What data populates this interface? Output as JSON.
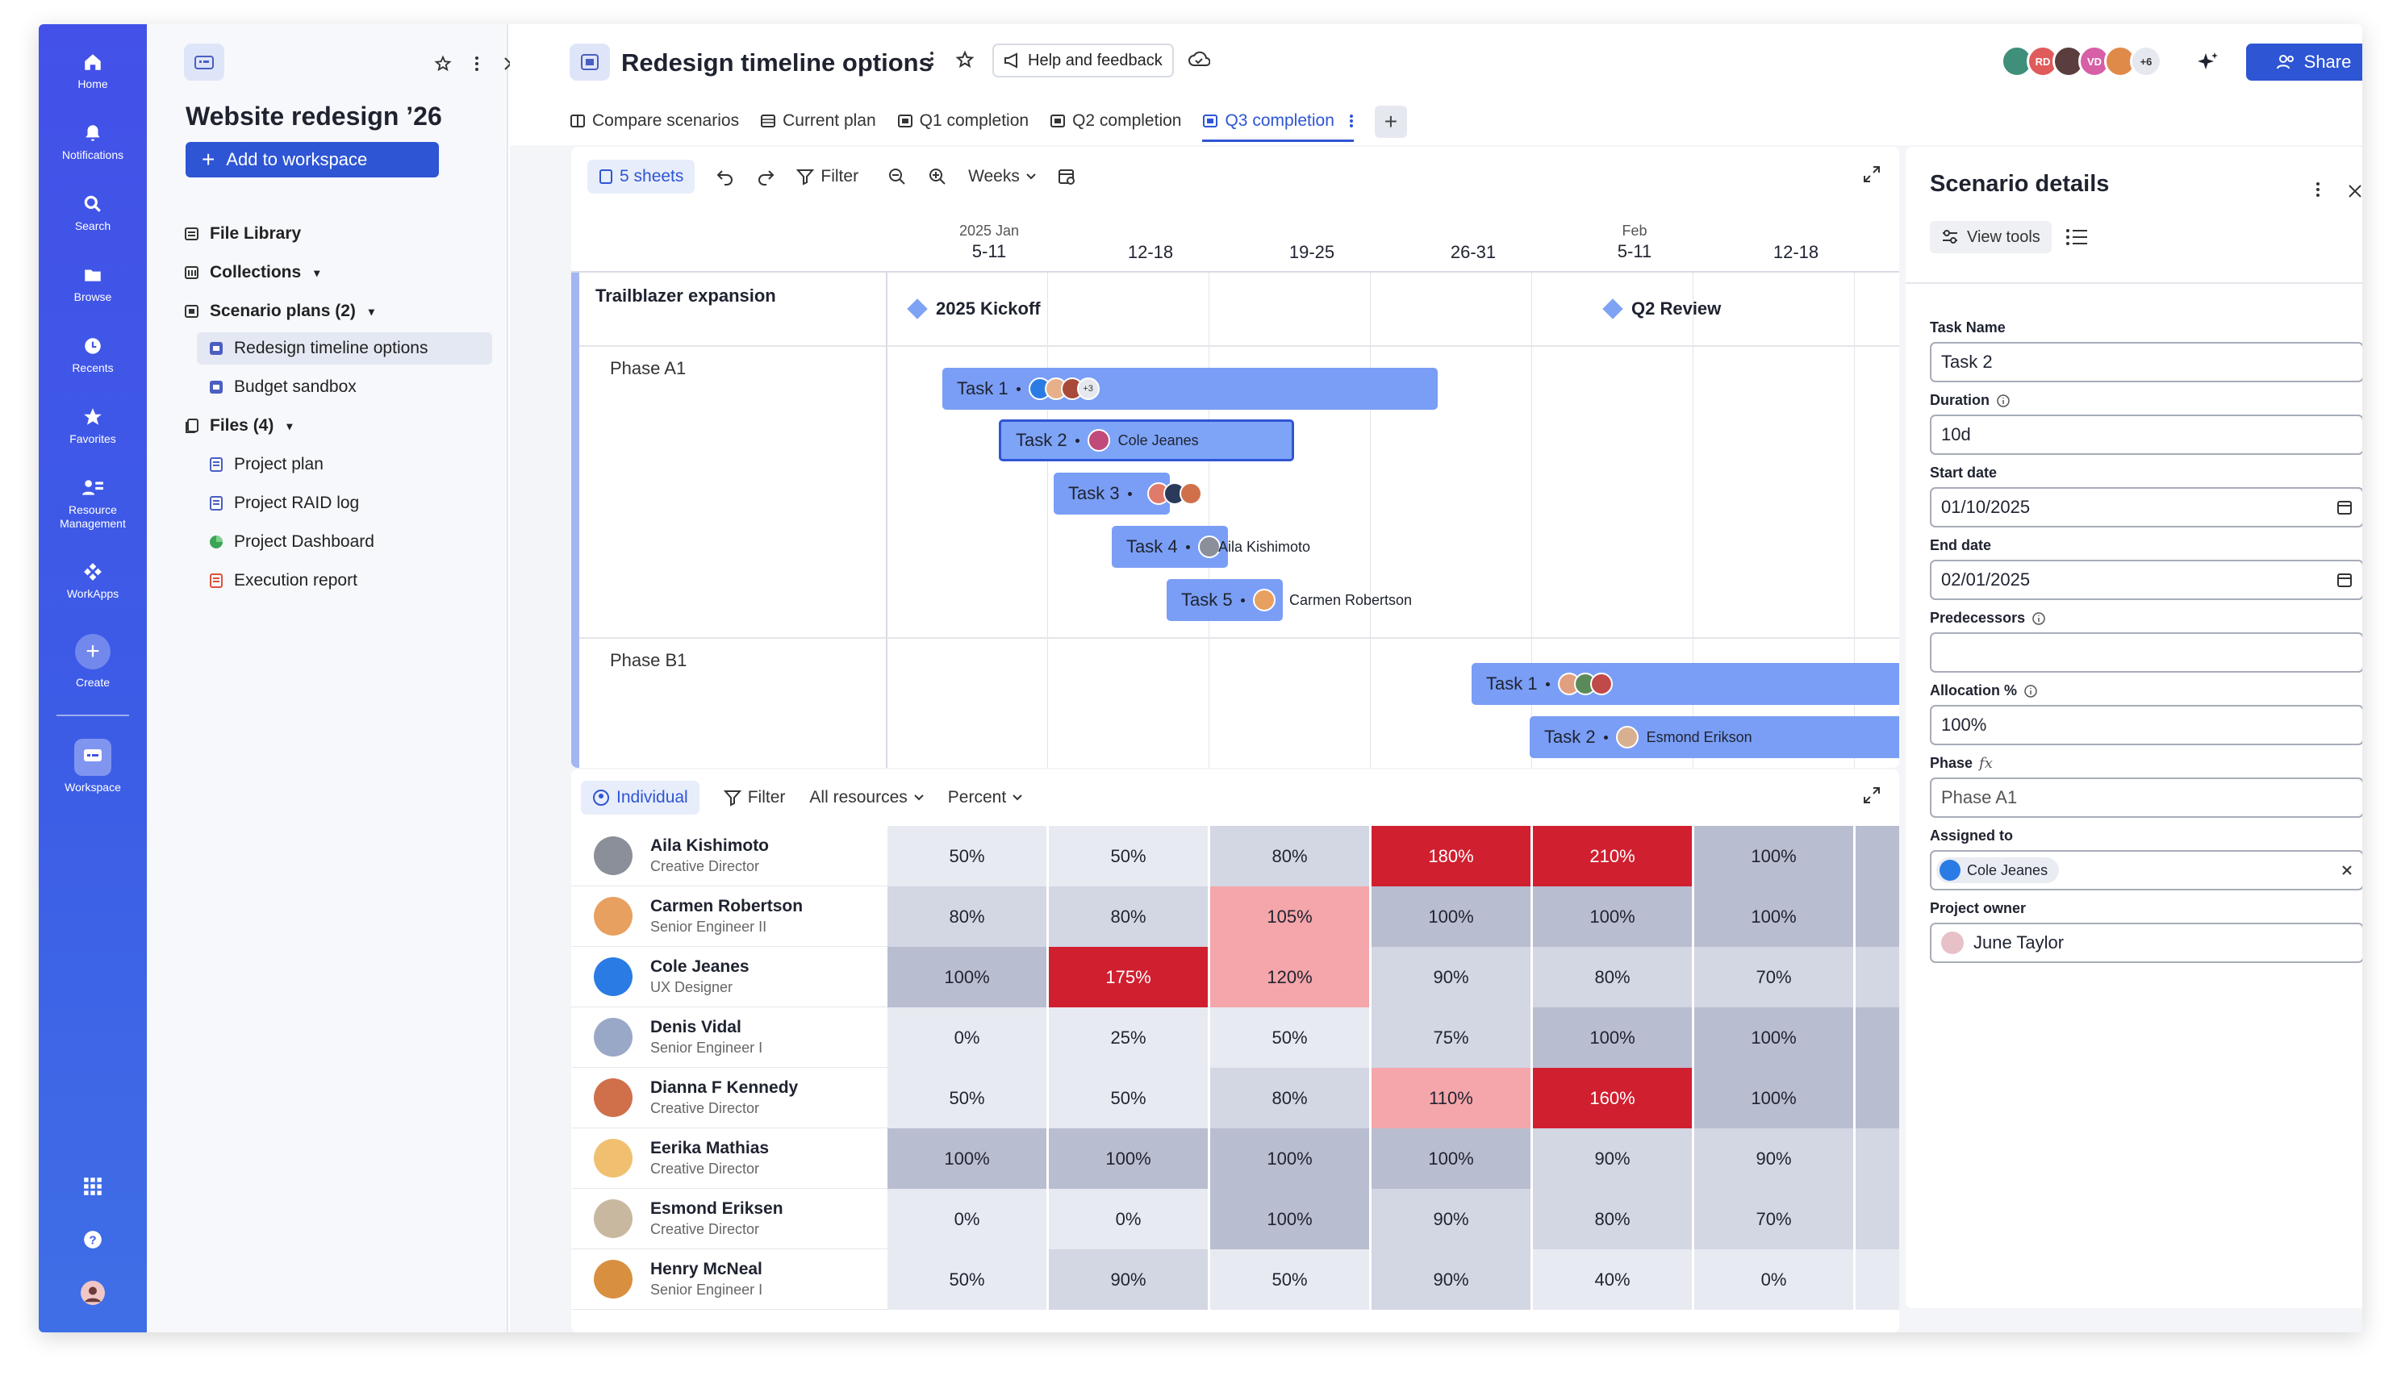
{
  "rail": {
    "items": [
      "Home",
      "Notifications",
      "Search",
      "Browse",
      "Recents",
      "Favorites",
      "Resource Management",
      "WorkApps",
      "Create",
      "Workspace"
    ]
  },
  "nav": {
    "title": "Website redesign ’26",
    "add_button": "Add to workspace",
    "tree": [
      {
        "label": "File Library"
      },
      {
        "label": "Collections"
      },
      {
        "label": "Scenario plans (2)"
      },
      {
        "label": "Redesign timeline options"
      },
      {
        "label": "Budget sandbox"
      },
      {
        "label": "Files (4)"
      },
      {
        "label": "Project plan"
      },
      {
        "label": "Project RAID log"
      },
      {
        "label": "Project Dashboard"
      },
      {
        "label": "Execution report"
      }
    ]
  },
  "header": {
    "title": "Redesign timeline options",
    "help": "Help and feedback",
    "share": "Share",
    "avatar_initials": [
      "RD",
      "VD"
    ],
    "avatar_more": "+6",
    "tabs": [
      "Compare scenarios",
      "Current plan",
      "Q1 completion",
      "Q2 completion",
      "Q3 completion"
    ]
  },
  "gantt": {
    "toolbar": {
      "sheets": "5 sheets",
      "filter": "Filter",
      "scale": "Weeks"
    },
    "months": [
      "2025 Jan",
      "Feb"
    ],
    "weeks": [
      "5-11",
      "12-18",
      "19-25",
      "26-31",
      "5-11",
      "12-18"
    ],
    "groups": {
      "title": "Trailblazer expansion",
      "phase_a": "Phase A1",
      "phase_b": "Phase B1"
    },
    "milestones": [
      "2025 Kickoff",
      "Q2 Review"
    ],
    "tasks": [
      {
        "label": "Task 1",
        "more": "+3"
      },
      {
        "label": "Task 2",
        "who": "Cole Jeanes"
      },
      {
        "label": "Task 3"
      },
      {
        "label": "Task 4",
        "who": "Aila Kishimoto"
      },
      {
        "label": "Task 5",
        "who": "Carmen Robertson"
      },
      {
        "label": "Task 1"
      },
      {
        "label": "Task 2",
        "who": "Esmond Erikson"
      }
    ]
  },
  "resources": {
    "toolbar": {
      "view": "Individual",
      "filter": "Filter",
      "scope": "All resources",
      "unit": "Percent"
    },
    "people": [
      {
        "name": "Aila Kishimoto",
        "role": "Creative Director",
        "values": [
          "50%",
          "50%",
          "80%",
          "180%",
          "210%",
          "100%"
        ]
      },
      {
        "name": "Carmen Robertson",
        "role": "Senior Engineer II",
        "values": [
          "80%",
          "80%",
          "105%",
          "100%",
          "100%",
          "100%"
        ]
      },
      {
        "name": "Cole Jeanes",
        "role": "UX Designer",
        "values": [
          "100%",
          "175%",
          "120%",
          "90%",
          "80%",
          "70%"
        ]
      },
      {
        "name": "Denis Vidal",
        "role": "Senior Engineer I",
        "values": [
          "0%",
          "25%",
          "50%",
          "75%",
          "100%",
          "100%"
        ]
      },
      {
        "name": "Dianna F Kennedy",
        "role": "Creative Director",
        "values": [
          "50%",
          "50%",
          "80%",
          "110%",
          "160%",
          "100%"
        ]
      },
      {
        "name": "Eerika Mathias",
        "role": "Creative Director",
        "values": [
          "100%",
          "100%",
          "100%",
          "100%",
          "90%",
          "90%"
        ]
      },
      {
        "name": "Esmond Eriksen",
        "role": "Creative Director",
        "values": [
          "0%",
          "0%",
          "100%",
          "90%",
          "80%",
          "70%"
        ]
      },
      {
        "name": "Henry McNeal",
        "role": "Senior Engineer I",
        "values": [
          "50%",
          "90%",
          "50%",
          "90%",
          "40%",
          "0%"
        ]
      }
    ]
  },
  "details": {
    "title": "Scenario details",
    "view_tools": "View tools",
    "fields": [
      {
        "label": "Task Name",
        "value": "Task 2"
      },
      {
        "label": "Duration",
        "value": "10d"
      },
      {
        "label": "Start date",
        "value": "01/10/2025"
      },
      {
        "label": "End date",
        "value": "02/01/2025"
      },
      {
        "label": "Predecessors",
        "value": ""
      },
      {
        "label": "Allocation %",
        "value": "100%"
      },
      {
        "label": "Phase",
        "value": "Phase A1"
      },
      {
        "label": "Assigned to",
        "value": "Cole Jeanes"
      },
      {
        "label": "Project owner",
        "value": "June Taylor"
      }
    ]
  }
}
